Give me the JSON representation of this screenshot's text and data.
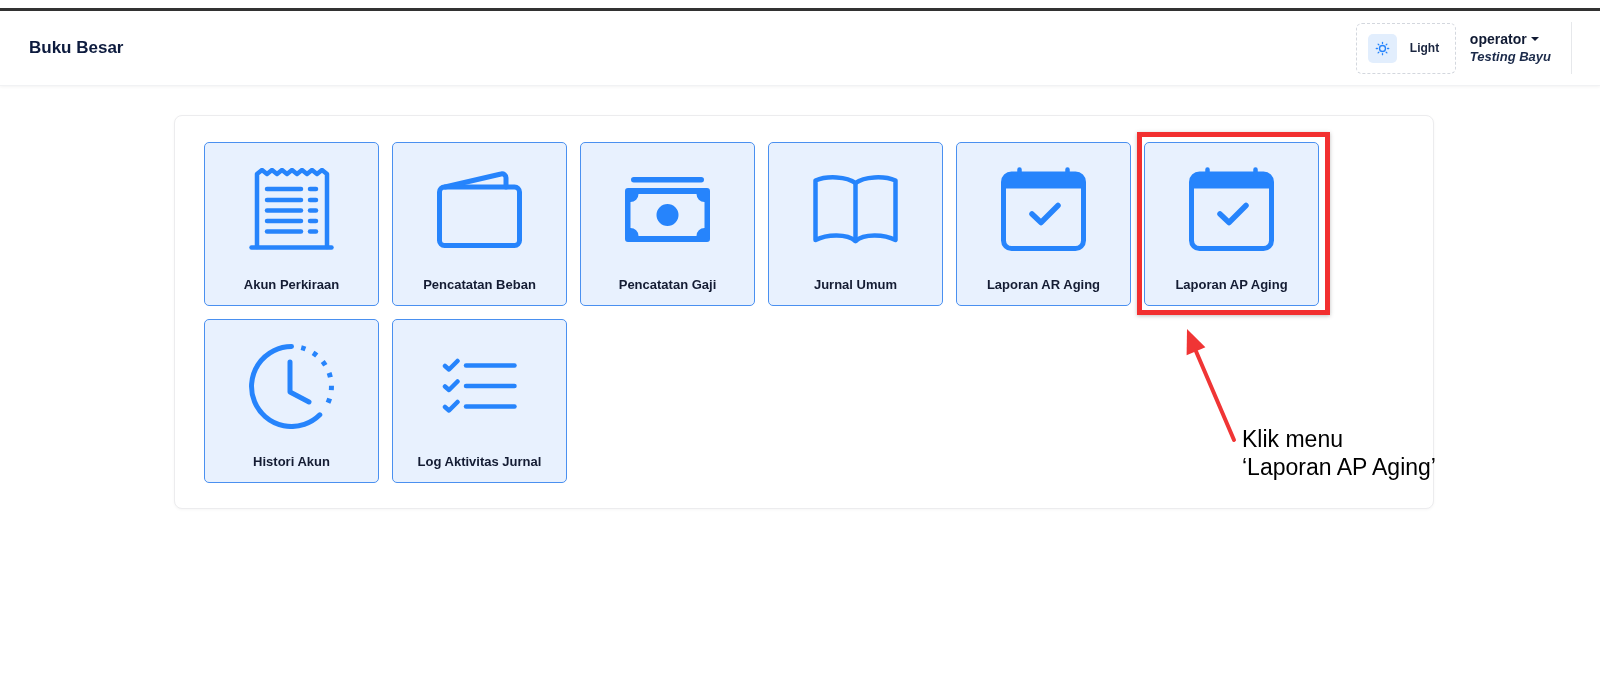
{
  "header": {
    "title": "Buku Besar",
    "theme_toggle": {
      "label": "Light"
    },
    "user": {
      "name": "operator",
      "role": "Testing Bayu"
    }
  },
  "menu": [
    {
      "kind": "receipt",
      "label": "Akun Perkiraan",
      "highlighted": false
    },
    {
      "kind": "wallet",
      "label": "Pencatatan Beban",
      "highlighted": false
    },
    {
      "kind": "banknote",
      "label": "Pencatatan Gaji",
      "highlighted": false
    },
    {
      "kind": "book",
      "label": "Jurnal Umum",
      "highlighted": false
    },
    {
      "kind": "calendar",
      "label": "Laporan AR Aging",
      "highlighted": false
    },
    {
      "kind": "calendar",
      "label": "Laporan AP Aging",
      "highlighted": true
    },
    {
      "kind": "clock",
      "label": "Histori Akun",
      "highlighted": false
    },
    {
      "kind": "checklist",
      "label": "Log Aktivitas Jurnal",
      "highlighted": false
    }
  ],
  "annotation": {
    "text": "Klik menu\n‘Laporan AP Aging’"
  }
}
